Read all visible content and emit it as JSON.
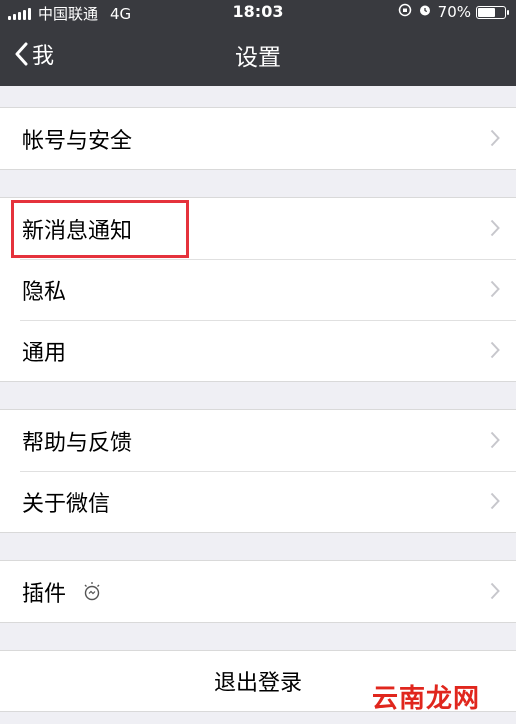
{
  "status_bar": {
    "carrier": "中国联通",
    "network": "4G",
    "time": "18:03",
    "battery_text": "70%",
    "battery_level": 0.7
  },
  "nav": {
    "back_label": "我",
    "title": "设置"
  },
  "groups": [
    {
      "items": [
        {
          "label": "帐号与安全"
        }
      ]
    },
    {
      "items": [
        {
          "label": "新消息通知"
        },
        {
          "label": "隐私"
        },
        {
          "label": "通用"
        }
      ]
    },
    {
      "items": [
        {
          "label": "帮助与反馈"
        },
        {
          "label": "关于微信"
        }
      ]
    },
    {
      "items": [
        {
          "label": "插件",
          "icon": "bulb-icon"
        }
      ]
    }
  ],
  "logout_label": "退出登录",
  "watermark": "云南龙网",
  "colors": {
    "bar_bg": "#393a3f",
    "page_bg": "#efeff4",
    "highlight": "#e5323c",
    "watermark": "#e0261d"
  }
}
